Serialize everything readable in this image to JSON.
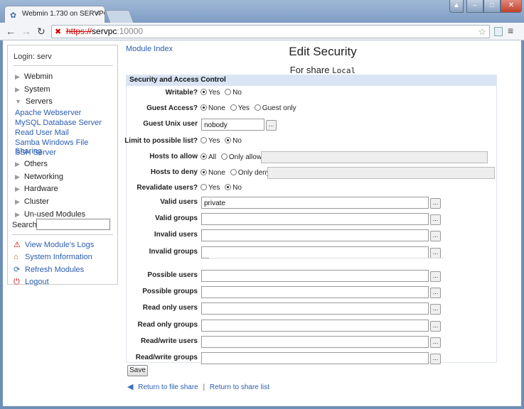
{
  "browser": {
    "tab_title": "Webmin 1.730 on SERVPC",
    "tab_close": "×",
    "url_scheme": "https://",
    "url_host": "servpc",
    "url_port": ":10000"
  },
  "sidebar": {
    "login": "Login: serv",
    "categories": [
      {
        "label": "Webmin"
      },
      {
        "label": "System"
      },
      {
        "label": "Servers"
      },
      {
        "label": "Others"
      },
      {
        "label": "Networking"
      },
      {
        "label": "Hardware"
      },
      {
        "label": "Cluster"
      },
      {
        "label": "Un-used Modules"
      }
    ],
    "servers_items": [
      "Apache Webserver",
      "MySQL Database Server",
      "Read User Mail",
      "Samba Windows File Sharing",
      "SSH Server"
    ],
    "search_label": "Search:",
    "actions": [
      "View Module's Logs",
      "System Information",
      "Refresh Modules",
      "Logout"
    ]
  },
  "main": {
    "module_index": "Module Index",
    "title": "Edit Security",
    "subtitle": "For share",
    "share_name": "Local",
    "section_header": "Security and Access Control",
    "fields": {
      "writable": {
        "label": "Writable?",
        "options": [
          "Yes",
          "No"
        ],
        "selected": "Yes"
      },
      "guest_access": {
        "label": "Guest Access?",
        "options": [
          "None",
          "Yes",
          "Guest only"
        ],
        "selected": "None"
      },
      "guest_unix_user": {
        "label": "Guest Unix user",
        "value": "nobody"
      },
      "limit_list": {
        "label": "Limit to possible list?",
        "options": [
          "Yes",
          "No"
        ],
        "selected": "No"
      },
      "hosts_allow": {
        "label": "Hosts to allow",
        "options": [
          "All",
          "Only allow"
        ],
        "selected": "All"
      },
      "hosts_deny": {
        "label": "Hosts to deny",
        "options": [
          "None",
          "Only deny"
        ],
        "selected": "None"
      },
      "revalidate": {
        "label": "Revalidate users?",
        "options": [
          "Yes",
          "No"
        ],
        "selected": "No"
      },
      "valid_users": {
        "label": "Valid users",
        "value": "private"
      },
      "valid_groups": {
        "label": "Valid groups",
        "value": ""
      },
      "invalid_users": {
        "label": "Invalid users",
        "value": ""
      },
      "invalid_groups": {
        "label": "Invalid groups",
        "value": ""
      },
      "possible_users": {
        "label": "Possible users",
        "value": ""
      },
      "possible_groups": {
        "label": "Possible groups",
        "value": ""
      },
      "readonly_users": {
        "label": "Read only users",
        "value": ""
      },
      "readonly_groups": {
        "label": "Read only groups",
        "value": ""
      },
      "rw_users": {
        "label": "Read/write users",
        "value": ""
      },
      "rw_groups": {
        "label": "Read/write groups",
        "value": ""
      }
    },
    "picker_label": "...",
    "save_label": "Save",
    "return_file_share": "Return to file share",
    "return_share_list": "Return to share list",
    "link_divider": "|"
  }
}
